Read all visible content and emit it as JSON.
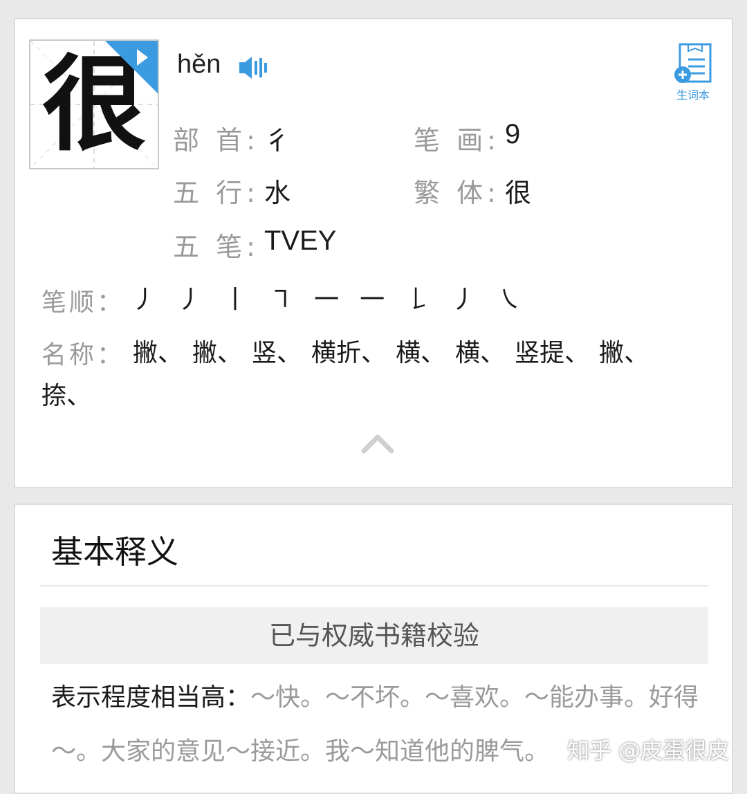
{
  "character": {
    "glyph": "很",
    "pinyin": "hěn"
  },
  "vocab": {
    "label": "生词本"
  },
  "attributes": {
    "radical_label": "部 首:",
    "radical_value": "彳",
    "strokes_count_label": "笔 画:",
    "strokes_count_value": "9",
    "wuxing_label": "五 行:",
    "wuxing_value": "水",
    "traditional_label": "繁 体:",
    "traditional_value": "很",
    "wubi_label": "五 笔:",
    "wubi_value": "TVEY"
  },
  "stroke_order": {
    "label": "笔顺：",
    "strokes": [
      "丿",
      "丿",
      "丨",
      "㇕",
      "一",
      "一",
      "𠄌",
      "丿",
      "㇏"
    ]
  },
  "stroke_names": {
    "label": "名称：",
    "names": [
      "撇、",
      "撇、",
      "竖、",
      "横折、",
      "横、",
      "横、",
      "竖提、",
      "撇、",
      "捺、"
    ]
  },
  "basic_meaning": {
    "title": "基本释义",
    "verified": "已与权威书籍校验",
    "lead": "表示程度相当高：",
    "examples": "～快。～不坏。～喜欢。～能办事。好得～。大家的意见～接近。我～知道他的脾气。"
  },
  "watermark": "知乎 @皮蛋很皮",
  "colors": {
    "accent": "#3b9be0",
    "label_gray": "#9a9a9a",
    "card_border": "#dcdcdc"
  },
  "icons": {
    "speaker": "speaker-icon",
    "vocab": "vocab-book-add-icon",
    "play": "play-corner-icon",
    "collapse": "chevron-up-icon"
  }
}
